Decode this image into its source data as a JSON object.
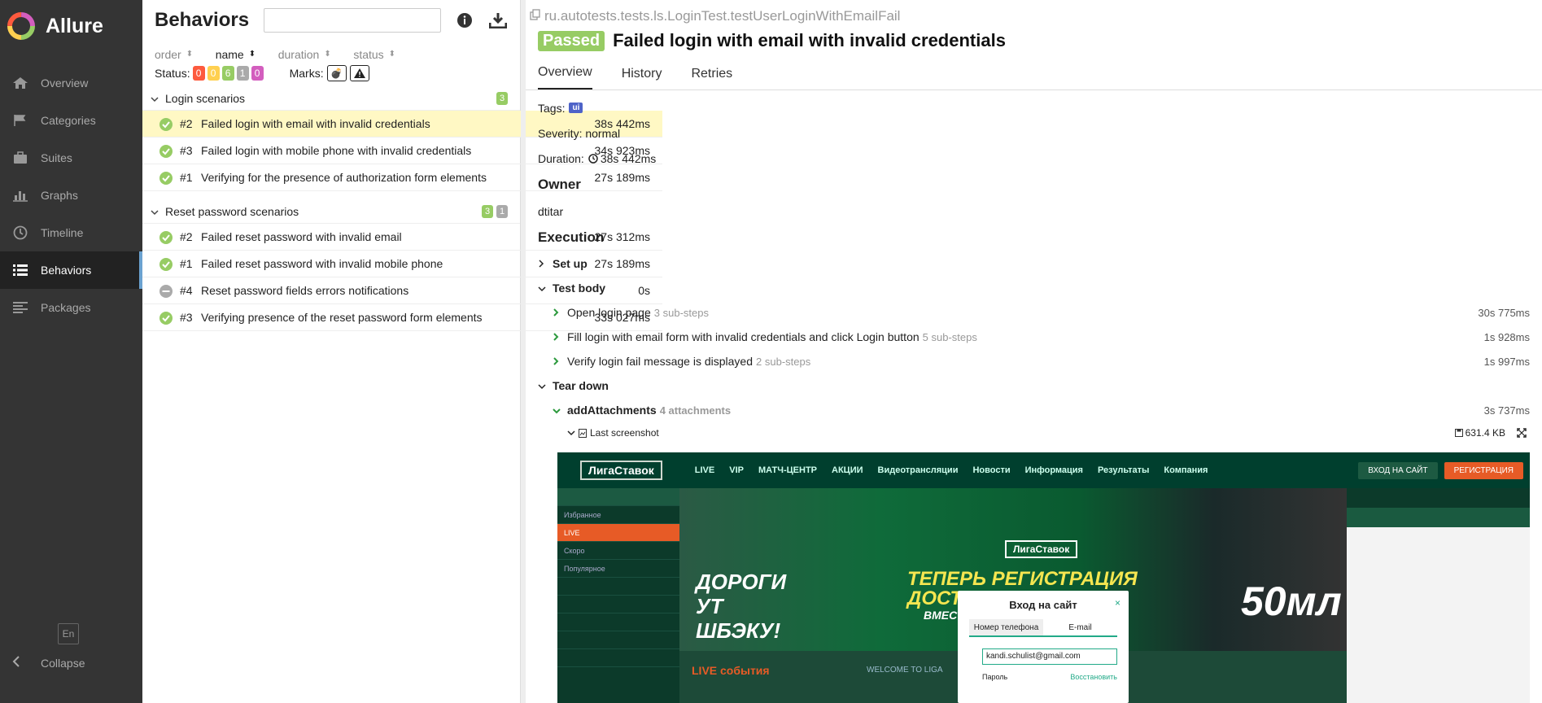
{
  "sidebar": {
    "brand": "Allure",
    "items": [
      {
        "label": "Overview",
        "icon": "home-icon"
      },
      {
        "label": "Categories",
        "icon": "flag-icon"
      },
      {
        "label": "Suites",
        "icon": "briefcase-icon"
      },
      {
        "label": "Graphs",
        "icon": "bar-chart-icon"
      },
      {
        "label": "Timeline",
        "icon": "clock-icon"
      },
      {
        "label": "Behaviors",
        "icon": "list-icon",
        "active": true
      },
      {
        "label": "Packages",
        "icon": "align-left-icon"
      }
    ],
    "lang": "En",
    "collapse": "Collapse"
  },
  "tree": {
    "title": "Behaviors",
    "search_placeholder": "",
    "sorters": {
      "order": "order",
      "name": "name",
      "duration": "duration",
      "status": "status"
    },
    "status_label": "Status:",
    "status_counts": {
      "failed": "0",
      "broken": "0",
      "passed": "6",
      "skipped": "1",
      "unknown": "0"
    },
    "marks_label": "Marks:",
    "groups": [
      {
        "name": "Login scenarios",
        "badges": [
          "3"
        ],
        "rows": [
          {
            "num": "#2",
            "name": "Failed login with email with invalid credentials",
            "duration": "38s 442ms"
          },
          {
            "num": "#3",
            "name": "Failed login with mobile phone with invalid credentials",
            "duration": "34s 923ms"
          },
          {
            "num": "#1",
            "name": "Verifying for the presence of authorization form elements",
            "duration": "27s 189ms"
          }
        ]
      },
      {
        "name": "Reset password scenarios",
        "badges": [
          "3",
          "1"
        ],
        "rows": [
          {
            "num": "#2",
            "name": "Failed reset password with invalid email",
            "duration": "27s 312ms"
          },
          {
            "num": "#1",
            "name": "Failed reset password with invalid mobile phone",
            "duration": "27s 189ms"
          },
          {
            "num": "#4",
            "name": "Reset password fields errors notifications",
            "duration": "0s"
          },
          {
            "num": "#3",
            "name": "Verifying presence of the reset password form elements",
            "duration": "33s 027ms"
          }
        ]
      }
    ]
  },
  "detail": {
    "path": "ru.autotests.tests.ls.LoginTest.testUserLoginWithEmailFail",
    "status": "Passed",
    "title": "Failed login with email with invalid credentials",
    "tabs": [
      "Overview",
      "History",
      "Retries"
    ],
    "tags_label": "Tags:",
    "tag": "ui",
    "severity": "Severity: normal",
    "duration_label": "Duration:",
    "duration": "38s 442ms",
    "owner_heading": "Owner",
    "owner": "dtitar",
    "execution_heading": "Execution",
    "setup": "Set up",
    "test_body": "Test body",
    "steps": [
      {
        "name": "Open login page",
        "sub": "3 sub-steps",
        "duration": "30s 775ms"
      },
      {
        "name": "Fill login with email form with invalid credentials and click Login button",
        "sub": "5 sub-steps",
        "duration": "1s 928ms"
      },
      {
        "name": "Verify login fail message is displayed",
        "sub": "2 sub-steps",
        "duration": "1s 997ms"
      }
    ],
    "tear_down": "Tear down",
    "attach": {
      "name": "addAttachments",
      "sub": "4 attachments",
      "duration": "3s 737ms"
    },
    "screenshot": {
      "name": "Last screenshot",
      "size": "631.4 KB"
    }
  },
  "screenshot_content": {
    "logo": "ЛигаСтавок",
    "menu": [
      "LIVE",
      "VIP",
      "МАТЧ-ЦЕНТР",
      "АКЦИИ",
      "Видеотрансляции",
      "Новости",
      "Информация",
      "Результаты",
      "Компания"
    ],
    "login_btn": "ВХОД НА САЙТ",
    "register_btn": "РЕГИСТРАЦИЯ",
    "left_items": [
      "Избранное",
      "LIVE",
      "Скоро",
      "Популярное"
    ],
    "banner_big": "ТЕПЕРЬ РЕГИСТРАЦИЯ\nДОСТУПНА ВСЕМ!",
    "banner_small": "ВМЕСТЕ, ЧТОБЫ ПОБЕЖДАТЬ!",
    "banner_left": "ДОРОГИ\nУТ\nШБЭКУ!",
    "banner_right": "50мл",
    "modal_title": "Вход на сайт",
    "modal_tab1": "Номер телефона",
    "modal_tab2": "E-mail",
    "modal_email": "kandi.schulist@gmail.com",
    "modal_pw": "Пароль",
    "modal_restore": "Восстановить",
    "live_events": "LIVE события",
    "welcome": "WELCOME TO LIGA"
  }
}
